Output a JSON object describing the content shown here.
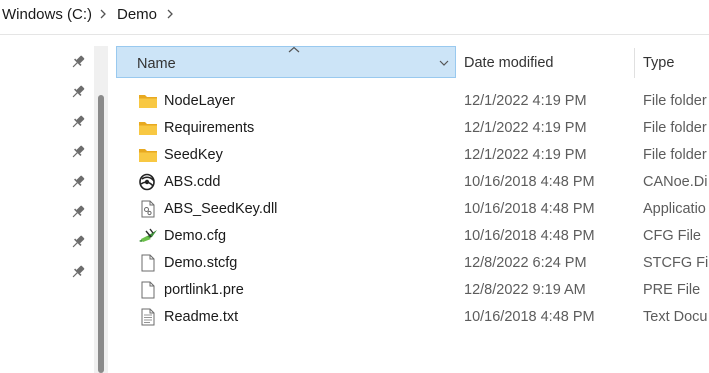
{
  "breadcrumb": {
    "items": [
      "Windows (C:)",
      "Demo"
    ]
  },
  "columns": {
    "name": "Name",
    "date_modified": "Date modified",
    "type": "Type"
  },
  "files": [
    {
      "name": "NodeLayer",
      "date": "12/1/2022 4:19 PM",
      "type": "File folder",
      "icon": "folder-icon"
    },
    {
      "name": "Requirements",
      "date": "12/1/2022 4:19 PM",
      "type": "File folder",
      "icon": "folder-icon"
    },
    {
      "name": "SeedKey",
      "date": "12/1/2022 4:19 PM",
      "type": "File folder",
      "icon": "folder-icon"
    },
    {
      "name": "ABS.cdd",
      "date": "10/16/2018 4:48 PM",
      "type": "CANoe.Di",
      "icon": "canoe-diag-icon"
    },
    {
      "name": "ABS_SeedKey.dll",
      "date": "10/16/2018 4:48 PM",
      "type": "Applicatio",
      "icon": "dll-file-icon"
    },
    {
      "name": "Demo.cfg",
      "date": "10/16/2018 4:48 PM",
      "type": "CFG File",
      "icon": "canoe-config-icon"
    },
    {
      "name": "Demo.stcfg",
      "date": "12/8/2022 6:24 PM",
      "type": "STCFG File",
      "icon": "blank-file-icon"
    },
    {
      "name": "portlink1.pre",
      "date": "12/8/2022 9:19 AM",
      "type": "PRE File",
      "icon": "blank-file-icon"
    },
    {
      "name": "Readme.txt",
      "date": "10/16/2018 4:48 PM",
      "type": "Text Docu",
      "icon": "text-file-icon"
    }
  ],
  "colors": {
    "header_selected_bg": "#cce4f7",
    "header_selected_border": "#99c9ef",
    "folder_yellow": "#f8c843"
  }
}
